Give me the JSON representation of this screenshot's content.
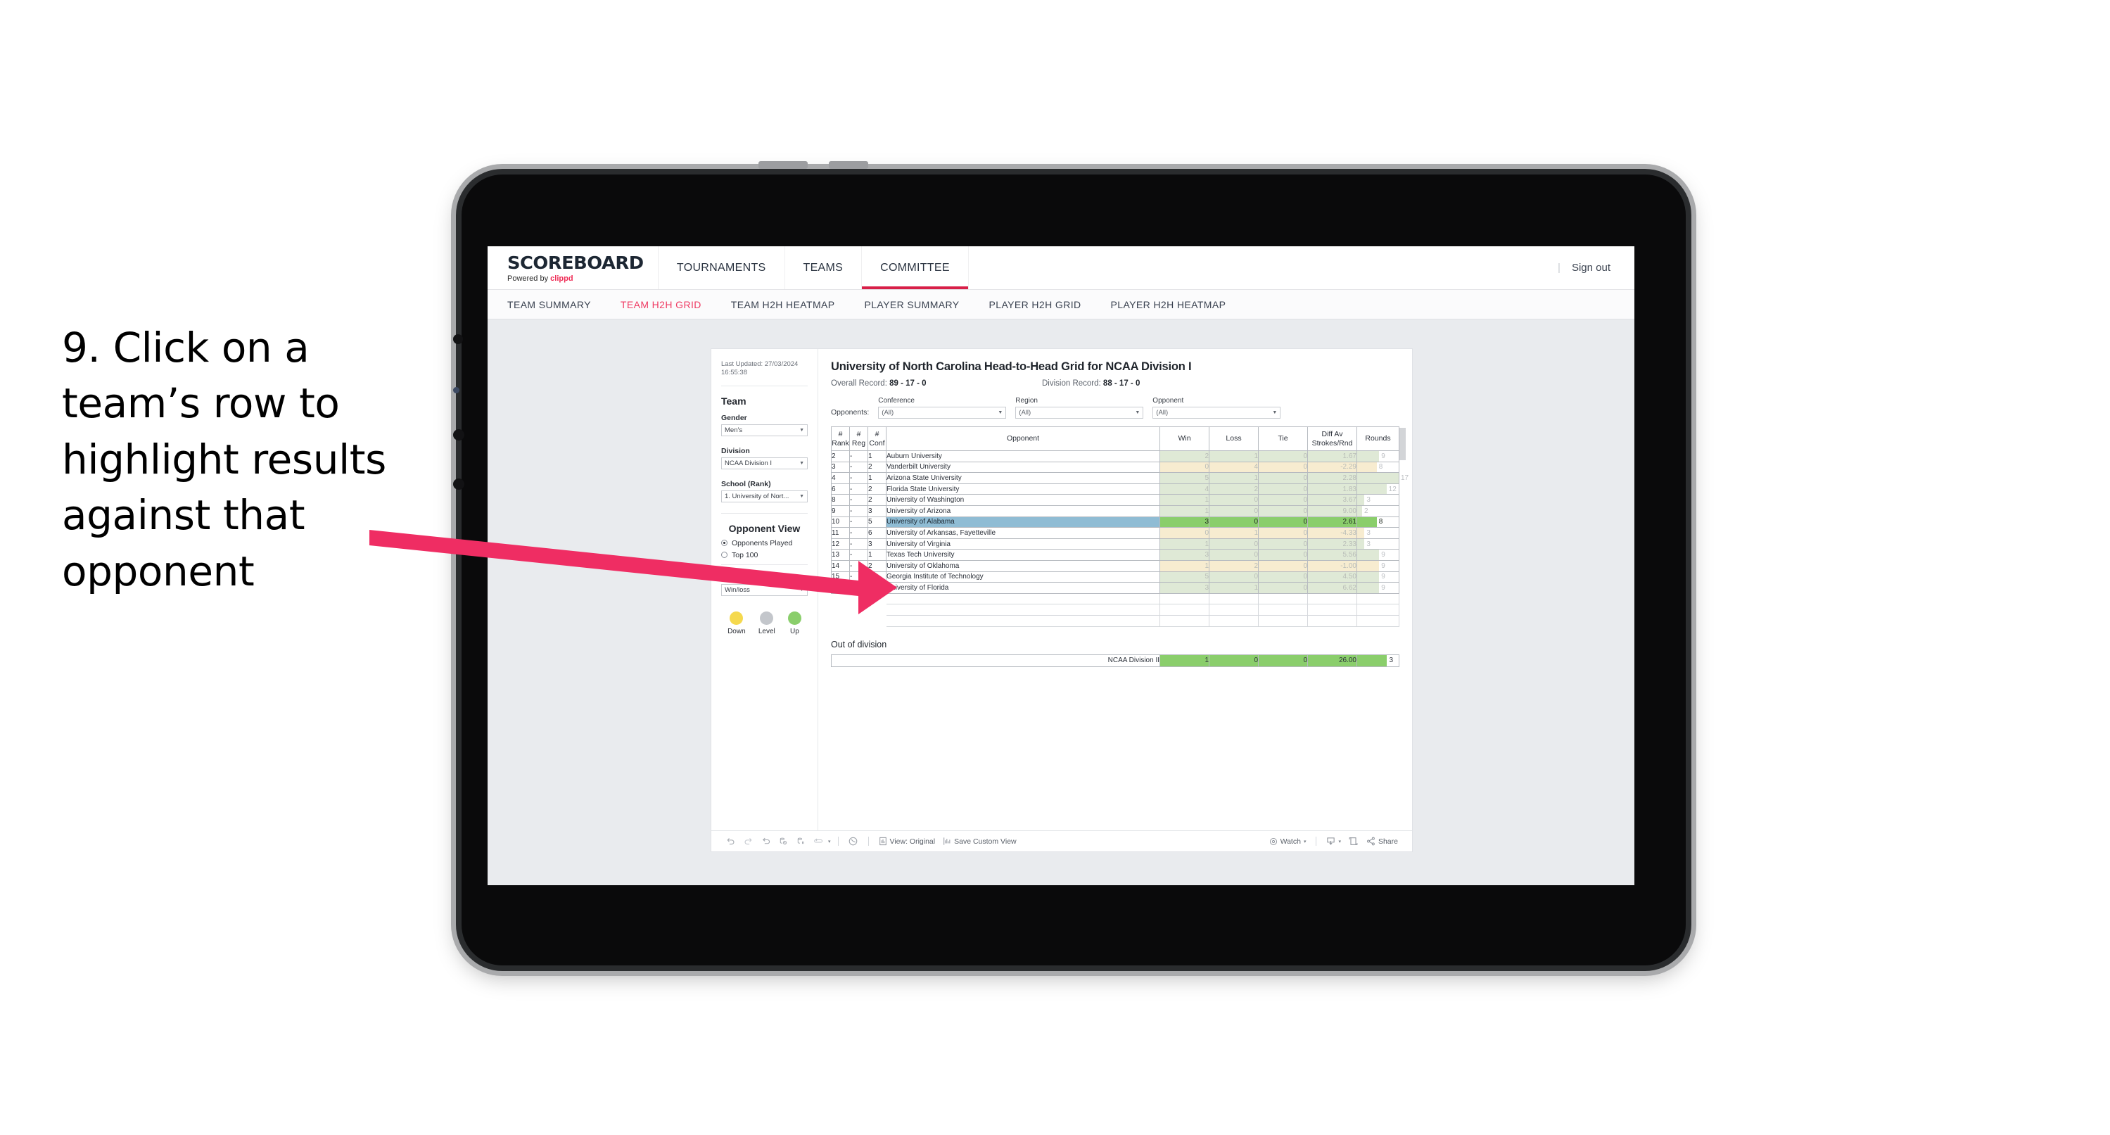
{
  "instruction": {
    "text": "9. Click on a team’s row to highlight results against that opponent"
  },
  "topbar": {
    "brand_title": "SCOREBOARD",
    "brand_sub_prefix": "Powered by ",
    "brand_sub_accent": "clippd",
    "nav": [
      {
        "label": "TOURNAMENTS",
        "active": false
      },
      {
        "label": "TEAMS",
        "active": false
      },
      {
        "label": "COMMITTEE",
        "active": true
      }
    ],
    "divider": "|",
    "sign_out": "Sign out"
  },
  "subnav": {
    "items": [
      {
        "label": "TEAM SUMMARY",
        "active": false
      },
      {
        "label": "TEAM H2H GRID",
        "active": true
      },
      {
        "label": "TEAM H2H HEATMAP",
        "active": false
      },
      {
        "label": "PLAYER SUMMARY",
        "active": false
      },
      {
        "label": "PLAYER H2H GRID",
        "active": false
      },
      {
        "label": "PLAYER H2H HEATMAP",
        "active": false
      }
    ]
  },
  "sidebar": {
    "last_updated": "Last Updated: 27/03/2024 16:55:38",
    "team_heading": "Team",
    "gender_label": "Gender",
    "gender_value": "Men’s",
    "division_label": "Division",
    "division_value": "NCAA Division I",
    "school_label": "School (Rank)",
    "school_value": "1. University of Nort...",
    "opponent_view_heading": "Opponent View",
    "opponent_view_options": [
      {
        "label": "Opponents Played",
        "checked": true
      },
      {
        "label": "Top 100",
        "checked": false
      }
    ],
    "colour_by_label": "Colour by",
    "colour_by_value": "Win/loss",
    "legend": [
      {
        "label": "Down",
        "color": "#f5d94e"
      },
      {
        "label": "Level",
        "color": "#c3c6cb"
      },
      {
        "label": "Up",
        "color": "#8ace6b"
      }
    ]
  },
  "main": {
    "title": "University of North Carolina Head-to-Head Grid for NCAA Division I",
    "overall_record_label": "Overall Record: ",
    "overall_record_value": "89 - 17 - 0",
    "division_record_label": "Division Record: ",
    "division_record_value": "88 - 17 - 0",
    "opponents_label": "Opponents:",
    "filters": [
      {
        "title": "Conference",
        "value": "(All)"
      },
      {
        "title": "Region",
        "value": "(All)"
      },
      {
        "title": "Opponent",
        "value": "(All)"
      }
    ],
    "columns": [
      "# Rank",
      "# Reg",
      "# Conf",
      "Opponent",
      "Win",
      "Loss",
      "Tie",
      "Diff Av Strokes/Rnd",
      "Rounds"
    ],
    "out_of_division_title": "Out of division",
    "out_of_division_row": {
      "name": "NCAA Division II",
      "win": "1",
      "loss": "0",
      "tie": "0",
      "diff": "26.00",
      "rounds": "3"
    }
  },
  "chart_data": {
    "type": "table",
    "title": "University of North Carolina Head-to-Head Grid for NCAA Division I",
    "columns": [
      "#Rank",
      "#Reg",
      "#Conf",
      "Opponent",
      "Win",
      "Loss",
      "Tie",
      "Diff Av Strokes/Rnd",
      "Rounds"
    ],
    "selected_row": "University of Alabama",
    "colour_by": "Win/loss",
    "rounds_max": 17,
    "rows": [
      {
        "rank": "2",
        "reg": "-",
        "conf": "1",
        "opponent": "Auburn University",
        "win": "2",
        "loss": "1",
        "tie": "0",
        "diff": "1.67",
        "rounds": "9",
        "state": "up",
        "selected": false
      },
      {
        "rank": "3",
        "reg": "-",
        "conf": "2",
        "opponent": "Vanderbilt University",
        "win": "0",
        "loss": "4",
        "tie": "0",
        "diff": "-2.29",
        "rounds": "8",
        "state": "down",
        "selected": false
      },
      {
        "rank": "4",
        "reg": "-",
        "conf": "1",
        "opponent": "Arizona State University",
        "win": "5",
        "loss": "1",
        "tie": "0",
        "diff": "2.28",
        "rounds": "17",
        "state": "up",
        "selected": false
      },
      {
        "rank": "6",
        "reg": "-",
        "conf": "2",
        "opponent": "Florida State University",
        "win": "4",
        "loss": "2",
        "tie": "0",
        "diff": "1.83",
        "rounds": "12",
        "state": "up",
        "selected": false
      },
      {
        "rank": "8",
        "reg": "-",
        "conf": "2",
        "opponent": "University of Washington",
        "win": "1",
        "loss": "0",
        "tie": "0",
        "diff": "3.67",
        "rounds": "3",
        "state": "up",
        "selected": false
      },
      {
        "rank": "9",
        "reg": "-",
        "conf": "3",
        "opponent": "University of Arizona",
        "win": "1",
        "loss": "0",
        "tie": "0",
        "diff": "9.00",
        "rounds": "2",
        "state": "up",
        "selected": false
      },
      {
        "rank": "10",
        "reg": "-",
        "conf": "5",
        "opponent": "University of Alabama",
        "win": "3",
        "loss": "0",
        "tie": "0",
        "diff": "2.61",
        "rounds": "8",
        "state": "up",
        "selected": true
      },
      {
        "rank": "11",
        "reg": "-",
        "conf": "6",
        "opponent": "University of Arkansas, Fayetteville",
        "win": "0",
        "loss": "1",
        "tie": "0",
        "diff": "-4.33",
        "rounds": "3",
        "state": "down",
        "selected": false
      },
      {
        "rank": "12",
        "reg": "-",
        "conf": "3",
        "opponent": "University of Virginia",
        "win": "1",
        "loss": "0",
        "tie": "0",
        "diff": "2.33",
        "rounds": "3",
        "state": "up",
        "selected": false
      },
      {
        "rank": "13",
        "reg": "-",
        "conf": "1",
        "opponent": "Texas Tech University",
        "win": "3",
        "loss": "0",
        "tie": "0",
        "diff": "5.56",
        "rounds": "9",
        "state": "up",
        "selected": false
      },
      {
        "rank": "14",
        "reg": "-",
        "conf": "2",
        "opponent": "University of Oklahoma",
        "win": "1",
        "loss": "2",
        "tie": "0",
        "diff": "-1.00",
        "rounds": "9",
        "state": "down",
        "selected": false
      },
      {
        "rank": "15",
        "reg": "-",
        "conf": "4",
        "opponent": "Georgia Institute of Technology",
        "win": "5",
        "loss": "0",
        "tie": "0",
        "diff": "4.50",
        "rounds": "9",
        "state": "up",
        "selected": false
      },
      {
        "rank": "16",
        "reg": "-",
        "conf": "7",
        "opponent": "University of Florida",
        "win": "3",
        "loss": "1",
        "tie": "0",
        "diff": "6.62",
        "rounds": "9",
        "state": "up",
        "selected": false
      }
    ]
  },
  "toolbar": {
    "view_label": "View: Original",
    "save_label": "Save Custom View",
    "watch_label": "Watch",
    "share_label": "Share",
    "caret": "▾"
  }
}
